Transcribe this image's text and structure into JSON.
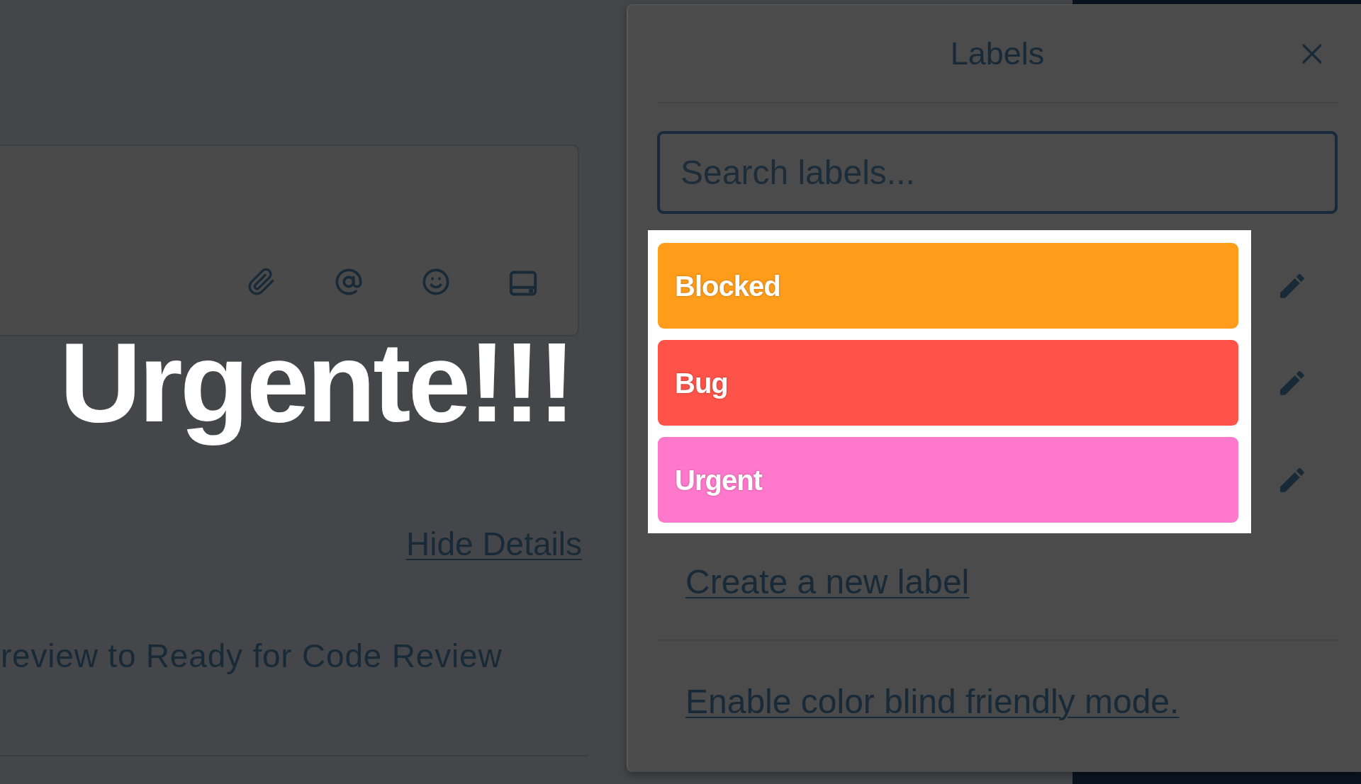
{
  "overlay_caption": "Urgente!!!",
  "activity": {
    "hide_details": "Hide Details",
    "entry": "review to Ready for Code Review"
  },
  "labels_popover": {
    "title": "Labels",
    "search": {
      "placeholder": "Search labels..."
    },
    "highlighted": true,
    "labels": [
      {
        "name": "Blocked",
        "color": "#ff9c1a"
      },
      {
        "name": "Bug",
        "color": "#ff5349"
      },
      {
        "name": "Urgent",
        "color": "#ff78cb"
      }
    ],
    "create_link": "Create a new label",
    "color_blind_link": "Enable color blind friendly mode."
  }
}
